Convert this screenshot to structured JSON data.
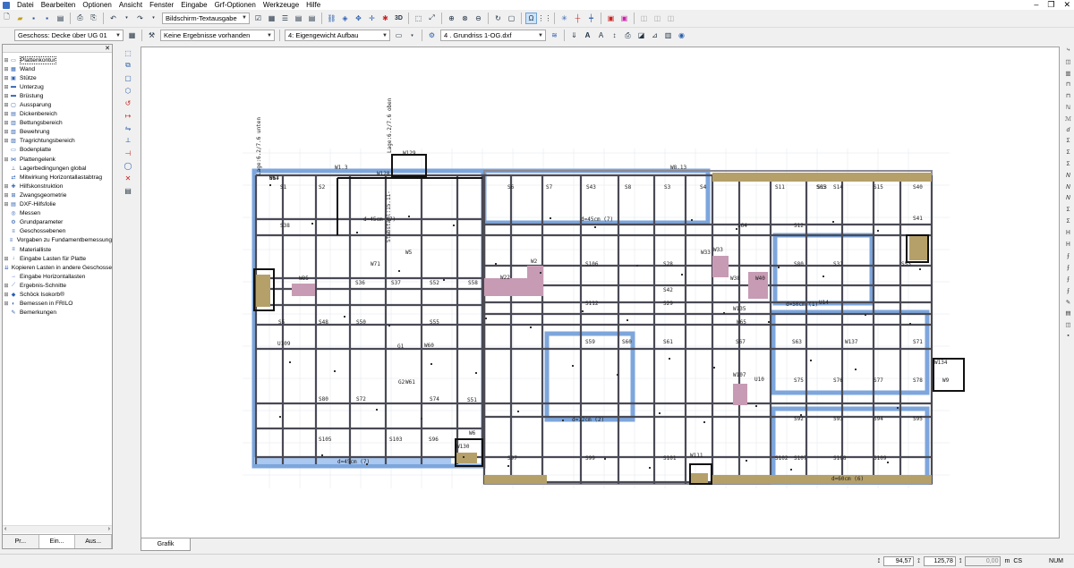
{
  "menu": [
    "Datei",
    "Bearbeiten",
    "Optionen",
    "Ansicht",
    "Fenster",
    "Eingabe",
    "Grf-Optionen",
    "Werkzeuge",
    "Hilfe"
  ],
  "toolbar1": {
    "view_combo": "Bildschirm-Textausgabe"
  },
  "toolbar2": {
    "floor_combo": "Geschoss: Decke über UG 01",
    "results_combo": "Keine Ergebnisse vorhanden",
    "loadcase_combo": "4: Eigengewicht Aufbau",
    "layer_combo": "4 . Grundriss 1-OG.dxf"
  },
  "tree": [
    {
      "label": "Plattenkontur",
      "exp": "+",
      "icon": "plate-icon",
      "glyph": "▭",
      "selected": true
    },
    {
      "label": "Wand",
      "exp": "+",
      "icon": "wall-icon",
      "glyph": "▦"
    },
    {
      "label": "Stütze",
      "exp": "+",
      "icon": "column-icon",
      "glyph": "▣"
    },
    {
      "label": "Unterzug",
      "exp": "+",
      "icon": "beam-icon",
      "glyph": "▬"
    },
    {
      "label": "Brüstung",
      "exp": "+",
      "icon": "parapet-icon",
      "glyph": "▬"
    },
    {
      "label": "Aussparung",
      "exp": "+",
      "icon": "opening-icon",
      "glyph": "▢"
    },
    {
      "label": "Dickenbereich",
      "exp": "+",
      "icon": "thickness-icon",
      "glyph": "▤"
    },
    {
      "label": "Bettungsbereich",
      "exp": "+",
      "icon": "bedding-icon",
      "glyph": "▥"
    },
    {
      "label": "Bewehrung",
      "exp": "+",
      "icon": "reinforcement-icon",
      "glyph": "▧"
    },
    {
      "label": "Tragrichtungsbereich",
      "exp": "+",
      "icon": "span-direction-icon",
      "glyph": "▨"
    },
    {
      "label": "Bodenplatte",
      "exp": "",
      "icon": "slab-icon",
      "glyph": "▭"
    },
    {
      "label": "Plattengelenk",
      "exp": "+",
      "icon": "hinge-icon",
      "glyph": "⋈"
    },
    {
      "label": "Lagerbedingungen global",
      "exp": "",
      "icon": "support-icon",
      "glyph": "⊥"
    },
    {
      "label": "Mitwirkung Horizontallastabtrag",
      "exp": "",
      "icon": "horizontal-load-icon",
      "glyph": "⇄"
    },
    {
      "label": "Hilfskonstruktion",
      "exp": "+",
      "icon": "construction-icon",
      "glyph": "✚"
    },
    {
      "label": "Zwangsgeometrie",
      "exp": "+",
      "icon": "constraint-icon",
      "glyph": "⊞"
    },
    {
      "label": "DXF-Hilfsfolie",
      "exp": "+",
      "icon": "dxf-icon",
      "glyph": "▤"
    },
    {
      "label": "Messen",
      "exp": "",
      "icon": "measure-icon",
      "glyph": "◎"
    },
    {
      "label": "Grundparameter",
      "exp": "",
      "icon": "parameters-icon",
      "glyph": "⚙"
    },
    {
      "label": "Geschossebenen",
      "exp": "",
      "icon": "floors-icon",
      "glyph": "≡"
    },
    {
      "label": "Vorgaben zu Fundamentbemessung",
      "exp": "",
      "icon": "foundation-icon",
      "glyph": "≡"
    },
    {
      "label": "Materialliste",
      "exp": "",
      "icon": "material-icon",
      "glyph": "≡"
    },
    {
      "label": "Eingabe Lasten für Platte",
      "exp": "+",
      "icon": "load-icon",
      "glyph": "↓"
    },
    {
      "label": "Kopieren Lasten in andere Geschosse",
      "exp": "",
      "icon": "copy-load-icon",
      "glyph": "⇊"
    },
    {
      "label": "Eingabe Horizontallasten",
      "exp": "",
      "icon": "hload-icon",
      "glyph": "→"
    },
    {
      "label": "Ergebnis-Schnitte",
      "exp": "+",
      "icon": "section-icon",
      "glyph": "⟋"
    },
    {
      "label": "Schöck Isokorb®",
      "exp": "+",
      "icon": "isokorb-icon",
      "glyph": "◆"
    },
    {
      "label": "Bemessen in FRILO",
      "exp": "+",
      "icon": "frilo-icon",
      "glyph": "◐"
    },
    {
      "label": "Bemerkungen",
      "exp": "",
      "icon": "notes-icon",
      "glyph": "✎"
    }
  ],
  "sidebar_tabs": [
    "Pr...",
    "Ein...",
    "Aus..."
  ],
  "canvas_tab": "Grafik",
  "status": {
    "x": "94,57",
    "y": "125,78",
    "z": "0,00",
    "unit": "m",
    "cs": "CS",
    "num": "NUM"
  },
  "plan_labels": [
    {
      "t": "W1.3"
    },
    {
      "t": "W8.13"
    },
    {
      "t": "W128"
    },
    {
      "t": "W129"
    },
    {
      "t": "S1"
    },
    {
      "t": "S2"
    },
    {
      "t": "S6"
    },
    {
      "t": "S7"
    },
    {
      "t": "S43"
    },
    {
      "t": "S8"
    },
    {
      "t": "S3"
    },
    {
      "t": "S4"
    },
    {
      "t": "d=45cm (7)"
    },
    {
      "t": "d=45cm (7)"
    },
    {
      "t": "W71"
    },
    {
      "t": "W5"
    },
    {
      "t": "W35"
    },
    {
      "t": "W22"
    },
    {
      "t": "W2"
    },
    {
      "t": "S106"
    },
    {
      "t": "S112"
    },
    {
      "t": "S28"
    },
    {
      "t": "S29"
    },
    {
      "t": "S42"
    },
    {
      "t": "S80"
    },
    {
      "t": "S31"
    },
    {
      "t": "W33"
    },
    {
      "t": "W38"
    },
    {
      "t": "W40"
    },
    {
      "t": "W135"
    },
    {
      "t": "W65"
    },
    {
      "t": "U14"
    },
    {
      "t": "d=50cm (1)"
    },
    {
      "t": "G1"
    },
    {
      "t": "W60"
    },
    {
      "t": "G2"
    },
    {
      "t": "W61"
    },
    {
      "t": "S59"
    },
    {
      "t": "S60"
    },
    {
      "t": "S61"
    },
    {
      "t": "S67"
    },
    {
      "t": "S63"
    },
    {
      "t": "W137"
    },
    {
      "t": "S71"
    },
    {
      "t": "S75"
    },
    {
      "t": "S76"
    },
    {
      "t": "S77"
    },
    {
      "t": "S78"
    },
    {
      "t": "W107"
    },
    {
      "t": "U10"
    },
    {
      "t": "d=12cm (2)"
    },
    {
      "t": "S92"
    },
    {
      "t": "S93"
    },
    {
      "t": "S94"
    },
    {
      "t": "S95"
    },
    {
      "t": "W6"
    },
    {
      "t": "W130"
    },
    {
      "t": "d=45cm (7)"
    },
    {
      "t": "W111"
    },
    {
      "t": "S101"
    },
    {
      "t": "S107"
    },
    {
      "t": "S108"
    },
    {
      "t": "S109"
    },
    {
      "t": "d=60cm (6)"
    },
    {
      "t": "W9"
    },
    {
      "t": "S80"
    },
    {
      "t": "S72"
    },
    {
      "t": "S74"
    },
    {
      "t": "S105"
    },
    {
      "t": "S103"
    },
    {
      "t": "S96"
    },
    {
      "t": "S97"
    },
    {
      "t": "S99"
    },
    {
      "t": "S102"
    },
    {
      "t": "W134"
    },
    {
      "t": "W33"
    },
    {
      "t": "S5"
    },
    {
      "t": "S48"
    },
    {
      "t": "S50"
    },
    {
      "t": "S55"
    },
    {
      "t": "U109"
    },
    {
      "t": "S51"
    },
    {
      "t": "S52"
    },
    {
      "t": "S58"
    },
    {
      "t": "S36"
    },
    {
      "t": "S37"
    },
    {
      "t": "S38"
    },
    {
      "t": "S11"
    },
    {
      "t": "S12"
    },
    {
      "t": "S13"
    },
    {
      "t": "S14"
    },
    {
      "t": "S15"
    },
    {
      "t": "S40"
    },
    {
      "t": "S41"
    },
    {
      "t": "S64"
    },
    {
      "t": "S65"
    },
    {
      "t": "S53"
    },
    {
      "t": "S54"
    },
    {
      "t": "U6"
    },
    {
      "t": "W17"
    }
  ],
  "plan_vertical_labels": [
    "Lage:6.2/7.6 unten",
    "Lage:6.2/7.6 oben",
    "Stabstahl:15.11-"
  ]
}
